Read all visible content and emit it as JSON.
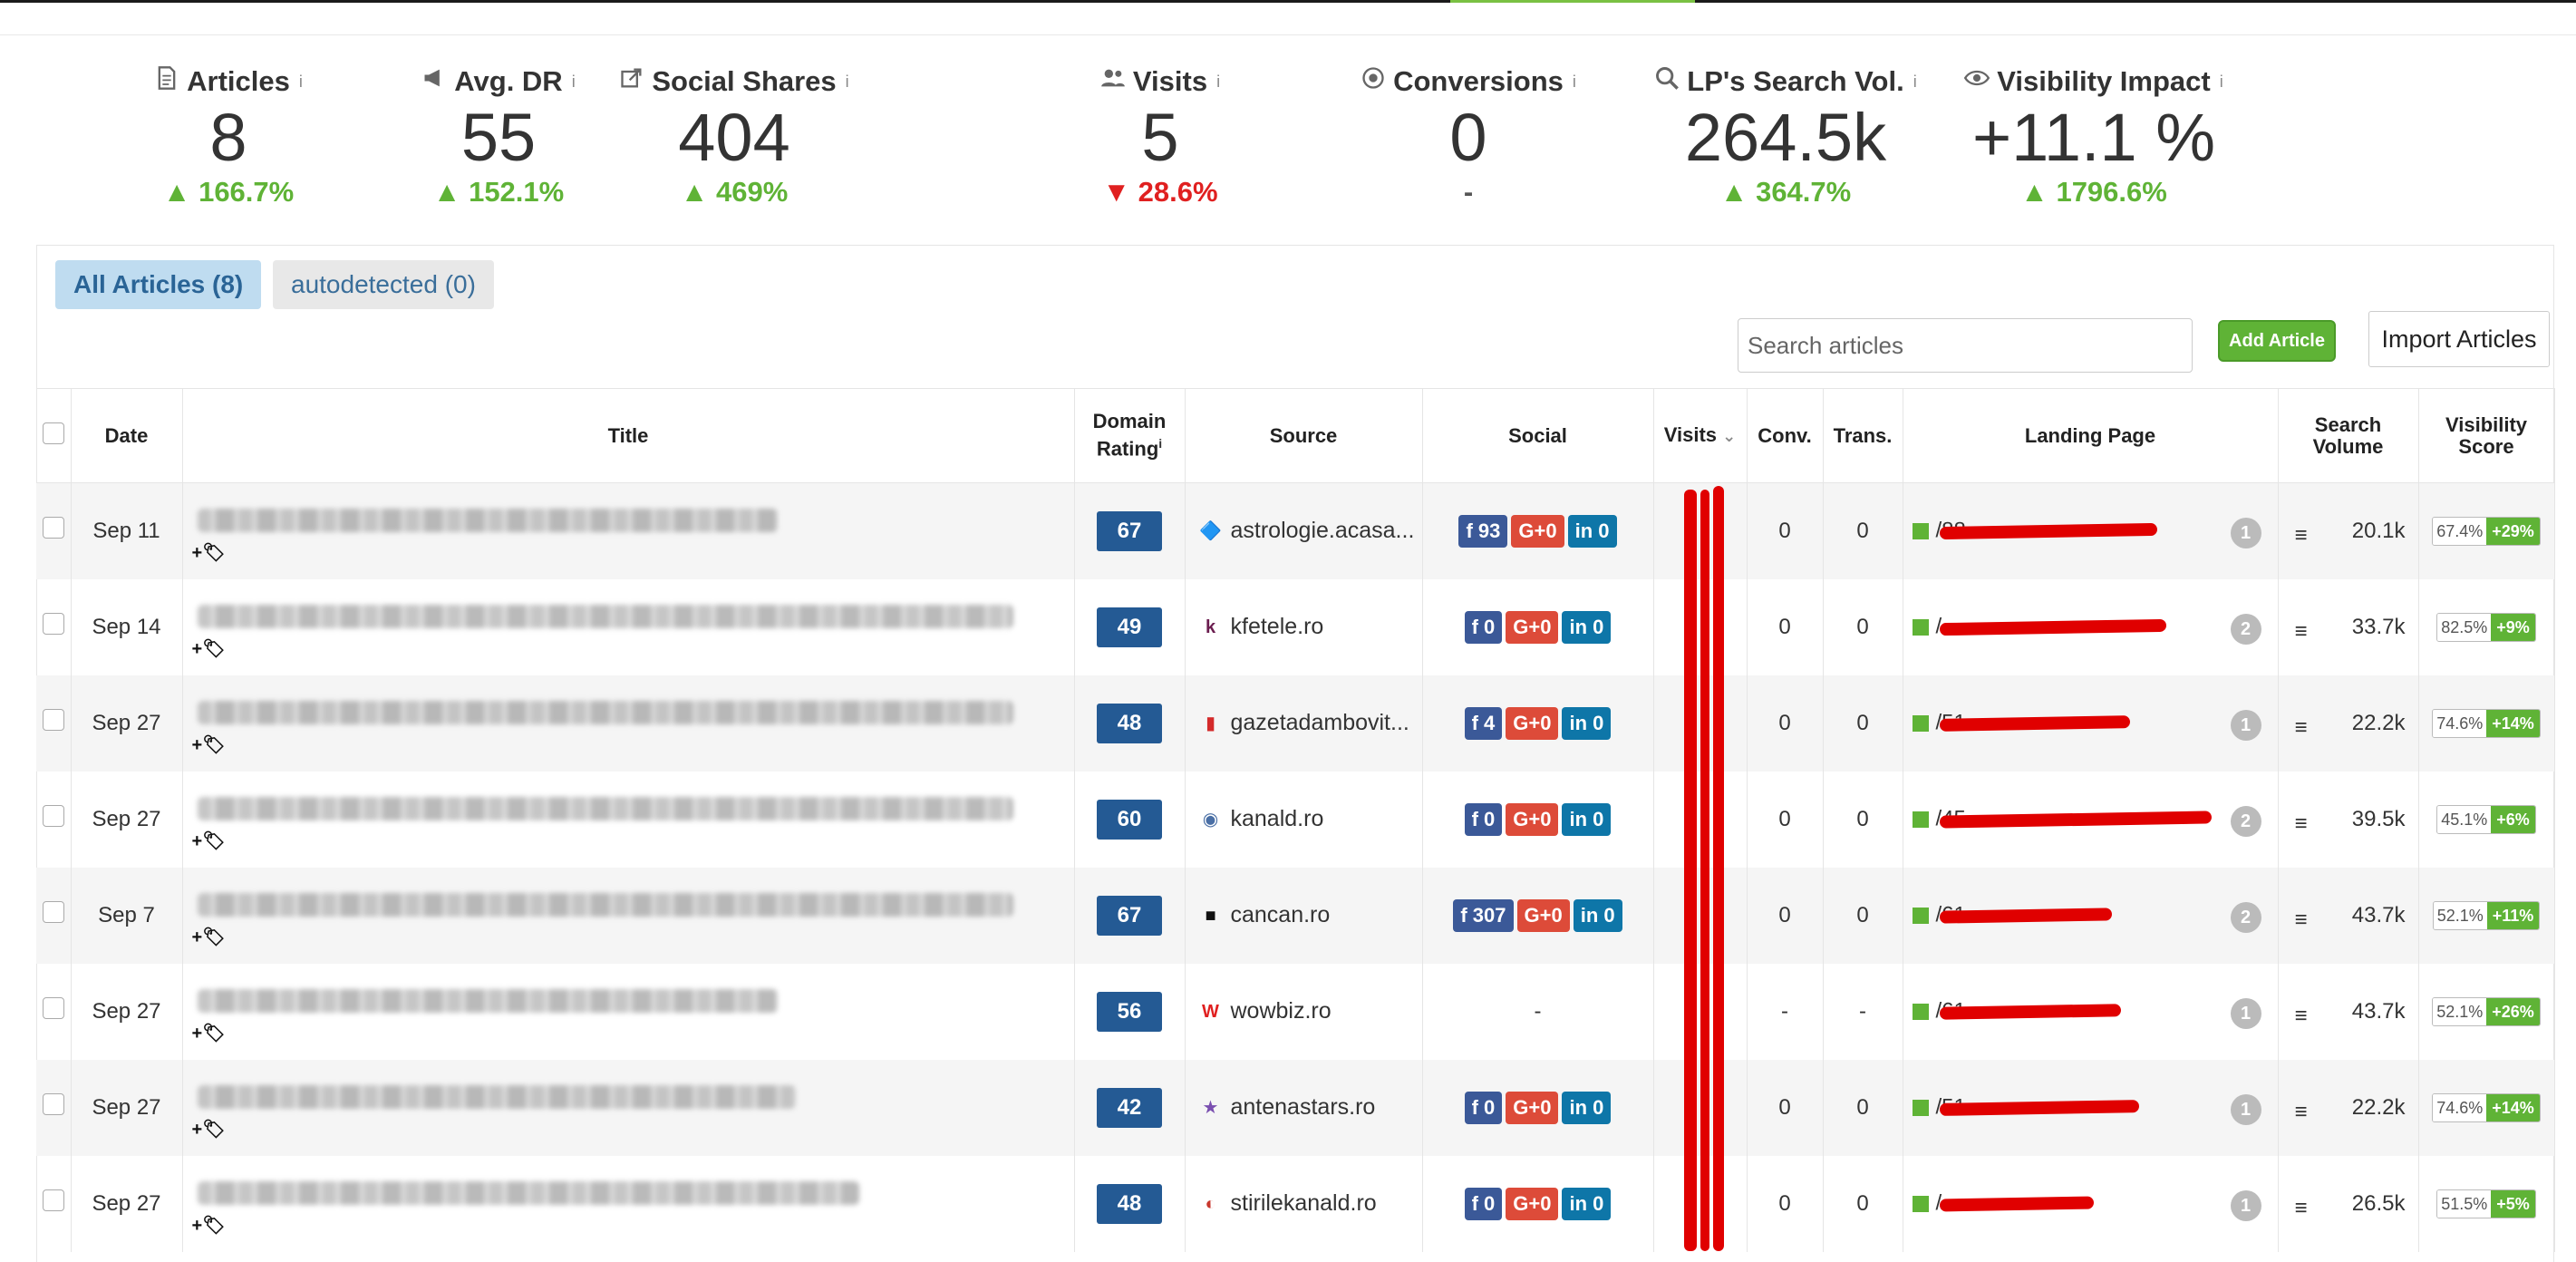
{
  "stats": [
    {
      "label": "Articles",
      "icon": "document-icon",
      "value": "8",
      "change": "▲ 166.7%",
      "trend": "up"
    },
    {
      "label": "Avg. DR",
      "icon": "megaphone-icon",
      "value": "55",
      "change": "▲ 152.1%",
      "trend": "up"
    },
    {
      "label": "Social Shares",
      "icon": "share-icon",
      "value": "404",
      "change": "▲ 469%",
      "trend": "up"
    },
    {
      "label": "Visits",
      "icon": "users-icon",
      "value": "5",
      "change": "▼ 28.6%",
      "trend": "down"
    },
    {
      "label": "Conversions",
      "icon": "target-icon",
      "value": "0",
      "change": "-",
      "trend": "neutral"
    },
    {
      "label": "LP's Search Vol.",
      "icon": "search-icon",
      "value": "264.5k",
      "change": "▲ 364.7%",
      "trend": "up"
    },
    {
      "label": "Visibility Impact",
      "icon": "eye-icon",
      "value": "+11.1 %",
      "change": "▲ 1796.6%",
      "trend": "up"
    }
  ],
  "info_mark": "i",
  "tabs": {
    "all": "All Articles (8)",
    "auto": "autodetected (0)"
  },
  "search": {
    "placeholder": "Search articles"
  },
  "buttons": {
    "add": "Add Article",
    "import": "Import Articles"
  },
  "columns": {
    "date": "Date",
    "title": "Title",
    "dr_line1": "Domain",
    "dr_line2": "Rating",
    "source": "Source",
    "social": "Social",
    "visits": "Visits",
    "conv": "Conv.",
    "trans": "Trans.",
    "landing": "Landing Page",
    "sv_line1": "Search",
    "sv_line2": "Volume",
    "vs_line1": "Visibility",
    "vs_line2": "Score"
  },
  "tag_label": "+",
  "rows": [
    {
      "date": "Sep 11",
      "dr": "67",
      "source": "astrologie.acasa...",
      "favicon": "🔷",
      "fav_color": "#5fb336",
      "fb": "f 93",
      "gp": "G+0",
      "li": "in 0",
      "conv": "0",
      "trans": "0",
      "lp": "/88",
      "lp_count": "1",
      "sv": "20.1k",
      "vis": "67.4%",
      "vis_chg": "+29%"
    },
    {
      "date": "Sep 14",
      "dr": "49",
      "source": "kfetele.ro",
      "favicon": "k",
      "fav_color": "#6b1d4f",
      "fb": "f 0",
      "gp": "G+0",
      "li": "in 0",
      "conv": "0",
      "trans": "0",
      "lp": "/",
      "lp_count": "2",
      "sv": "33.7k",
      "vis": "82.5%",
      "vis_chg": "+9%"
    },
    {
      "date": "Sep 27",
      "dr": "48",
      "source": "gazetadambovit...",
      "favicon": "▮",
      "fav_color": "#d42a2a",
      "fb": "f 4",
      "gp": "G+0",
      "li": "in 0",
      "conv": "0",
      "trans": "0",
      "lp": "/51",
      "lp_count": "1",
      "sv": "22.2k",
      "vis": "74.6%",
      "vis_chg": "+14%"
    },
    {
      "date": "Sep 27",
      "dr": "60",
      "source": "kanald.ro",
      "favicon": "◉",
      "fav_color": "#4a6fa5",
      "fb": "f 0",
      "gp": "G+0",
      "li": "in 0",
      "conv": "0",
      "trans": "0",
      "lp": "/45",
      "lp_count": "2",
      "sv": "39.5k",
      "vis": "45.1%",
      "vis_chg": "+6%"
    },
    {
      "date": "Sep 7",
      "dr": "67",
      "source": "cancan.ro",
      "favicon": "■",
      "fav_color": "#111111",
      "fb": "f 307",
      "gp": "G+0",
      "li": "in 0",
      "conv": "0",
      "trans": "0",
      "lp": "/61",
      "lp_count": "2",
      "sv": "43.7k",
      "vis": "52.1%",
      "vis_chg": "+11%"
    },
    {
      "date": "Sep 27",
      "dr": "56",
      "source": "wowbiz.ro",
      "favicon": "W",
      "fav_color": "#e02020",
      "fb": "",
      "gp": "",
      "li": "",
      "social_dash": "-",
      "conv": "-",
      "trans": "-",
      "lp": "/61",
      "lp_count": "1",
      "sv": "43.7k",
      "vis": "52.1%",
      "vis_chg": "+26%"
    },
    {
      "date": "Sep 27",
      "dr": "42",
      "source": "antenastars.ro",
      "favicon": "★",
      "fav_color": "#7a4fb0",
      "fb": "f 0",
      "gp": "G+0",
      "li": "in 0",
      "conv": "0",
      "trans": "0",
      "lp": "/51",
      "lp_count": "1",
      "sv": "22.2k",
      "vis": "74.6%",
      "vis_chg": "+14%"
    },
    {
      "date": "Sep 27",
      "dr": "48",
      "source": "stirilekanald.ro",
      "favicon": "◐",
      "fav_color": "#c8372d",
      "fb": "f 0",
      "gp": "G+0",
      "li": "in 0",
      "conv": "0",
      "trans": "0",
      "lp": "/",
      "lp_count": "1",
      "sv": "26.5k",
      "vis": "51.5%",
      "vis_chg": "+5%"
    }
  ]
}
